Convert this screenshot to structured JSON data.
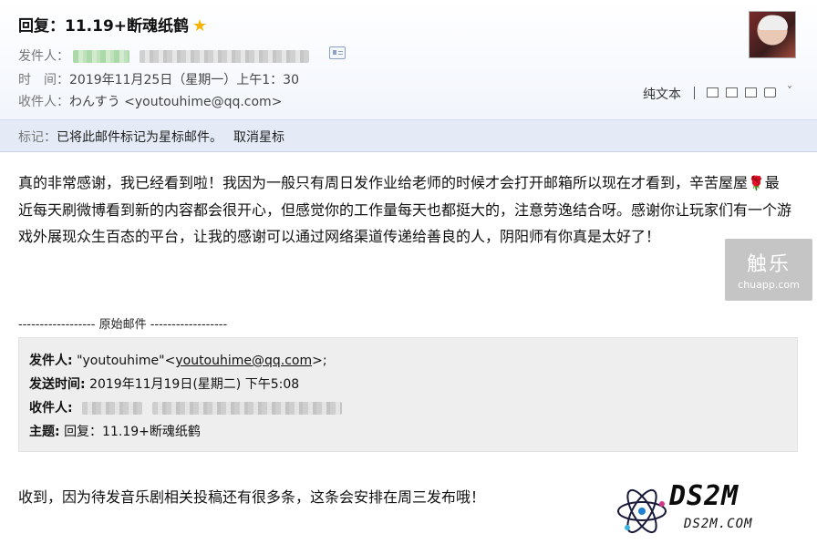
{
  "subject": "回复：11.19+断魂纸鹤",
  "sender": {
    "label": "发件人："
  },
  "time": {
    "label": "时　间：",
    "value": "2019年11月25日（星期一）上午1：30"
  },
  "recipient": {
    "label": "收件人：",
    "value": "わんすう <youtouhime@qq.com>"
  },
  "toolbar": {
    "plain_text": "纯文本"
  },
  "flag": {
    "label": "标记：",
    "message": "已将此邮件标记为星标邮件。",
    "cancel": "取消星标"
  },
  "body": {
    "part1": "真的非常感谢，我已经看到啦！我因为一般只有周日发作业给老师的时候才会打开邮箱所以现在才看到，辛苦屋屋",
    "part2": "最近每天刷微博看到新的内容都会很开心，但感觉你的工作量每天也都挺大的，注意劳逸结合呀。感谢你让玩家们有一个游戏外展现众生百态的平台，让我的感谢可以通过网络渠道传递给善良的人，阴阳师有你真是太好了！"
  },
  "original": {
    "separator": "------------------ 原始邮件 ------------------",
    "from_label": "发件人:",
    "from_name": "\"youtouhime\"<",
    "from_email": "youtouhime@qq.com",
    "from_end": ">;",
    "sent_label": "发送时间:",
    "sent_value": "2019年11月19日(星期二) 下午5:08",
    "to_label": "收件人:",
    "subject_label": "主题:",
    "subject_value": "回复：11.19+断魂纸鹤"
  },
  "reply": "收到，因为待发音乐剧相关投稿还有很多条，这条会安排在周三发布哦！",
  "watermarks": {
    "chuapp_big": "触乐",
    "chuapp_small": "chuapp.com",
    "ds2m_logo": "DS2M",
    "ds2m_url": "DS2M.COM"
  },
  "icons": [
    "star-icon",
    "contact-card-icon",
    "avatar",
    "new-window-icon",
    "print-icon",
    "chevron-down-icon",
    "rose-icon"
  ],
  "colors": {
    "star": "#f4b400",
    "flagbar": "#e4ebf6",
    "quote_bg": "#eeeeee"
  }
}
